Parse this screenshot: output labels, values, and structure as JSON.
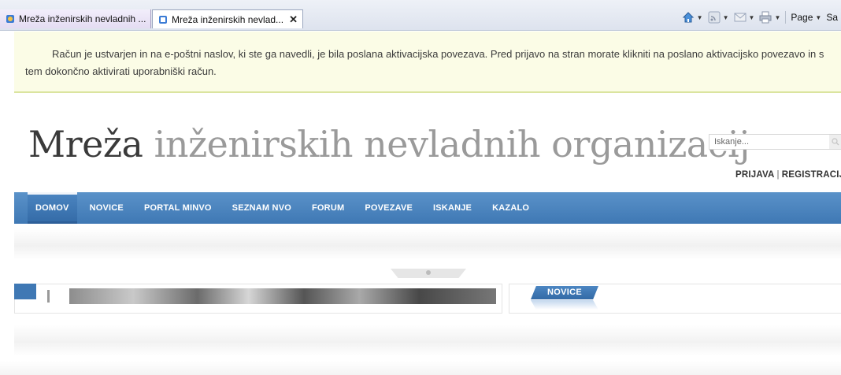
{
  "browser": {
    "tabs": [
      {
        "title": "Mreža inženirskih nevladnih ..."
      },
      {
        "title": "Mreža inženirskih nevlad...",
        "close": "✕"
      }
    ],
    "command_bar": {
      "page_label": "Page",
      "safety_label": "Sa"
    }
  },
  "notice": {
    "message": "Račun je ustvarjen in na e-poštni naslov, ki ste ga navedli, je bila poslana aktivacijska povezava. Pred prijavo na stran morate klikniti na poslano aktivacijsko povezavo in s tem dokončno aktivirati uporabniški račun."
  },
  "header": {
    "title_strong": "Mreža",
    "title_light": "inženirskih nevladnih organizacij",
    "search_placeholder": "Iskanje...",
    "login_label": "PRIJAVA",
    "auth_separator": "|",
    "register_label": "REGISTRACIJA"
  },
  "nav": {
    "items": [
      {
        "label": "DOMOV"
      },
      {
        "label": "NOVICE"
      },
      {
        "label": "PORTAL MINVO"
      },
      {
        "label": "SEZNAM NVO"
      },
      {
        "label": "FORUM"
      },
      {
        "label": "POVEZAVE"
      },
      {
        "label": "ISKANJE"
      },
      {
        "label": "KAZALO"
      }
    ]
  },
  "content": {
    "news_tab_label": "NOVICE"
  },
  "colors": {
    "nav_blue": "#3f78b4",
    "notice_bg": "#fbfce6",
    "notice_border": "#dbe49f"
  }
}
